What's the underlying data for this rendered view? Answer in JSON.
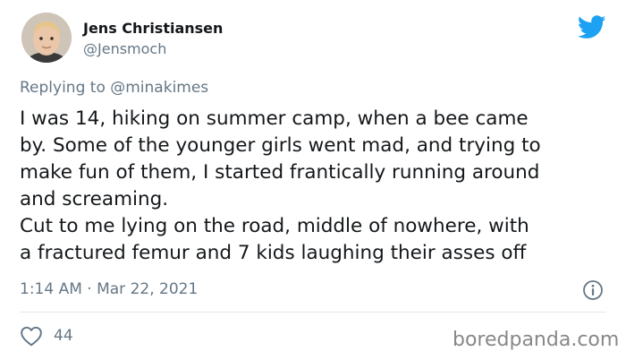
{
  "author": {
    "name": "Jens Christiansen",
    "handle": "@Jensmoch",
    "avatar_icon": "child-portrait-avatar"
  },
  "brand_icon": "twitter-bird-icon",
  "reply": {
    "prefix": "Replying to ",
    "mention": "@minakimes"
  },
  "tweet": {
    "lines": [
      "I was 14, hiking on summer camp, when a bee came",
      "by. Some of the younger girls went mad, and trying to",
      "make fun of them, I started frantically running around",
      "and screaming.",
      "Cut to me lying on the road, middle of nowhere, with",
      "a fractured femur and 7 kids laughing their asses off"
    ]
  },
  "meta": {
    "timestamp": "1:14 AM · Mar 22, 2021",
    "info_icon": "info-icon"
  },
  "actions": {
    "likes": "44",
    "like_icon": "heart-icon"
  },
  "watermark": "boredpanda.com",
  "colors": {
    "twitter_blue": "#1da1f2",
    "secondary_text": "#657786",
    "primary_text": "#14171a",
    "divider": "#e1e8ed"
  }
}
